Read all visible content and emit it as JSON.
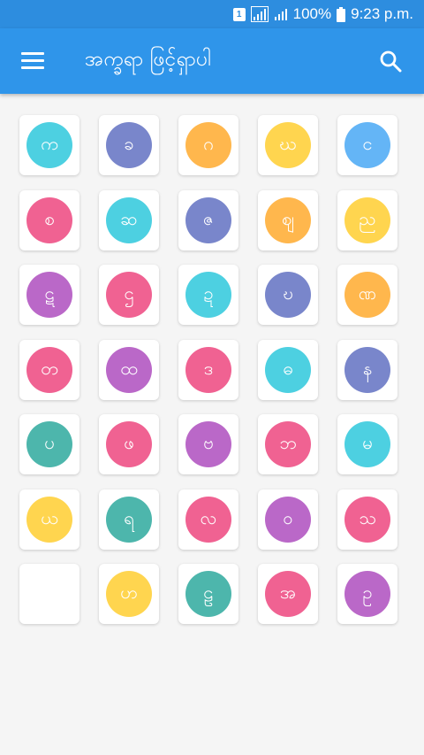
{
  "status_bar": {
    "sim_label": "1",
    "battery_text": "100%",
    "time": "9:23 p.m."
  },
  "app_bar": {
    "title": "အက္ခရာ ဖြင့်ရှာပါ",
    "menu_icon": "hamburger-menu-icon",
    "search_icon": "search-icon"
  },
  "colors": {
    "status_bar": "#2d8ddf",
    "app_bar": "#2f95ea",
    "background": "#f5f5f5"
  },
  "letters": [
    {
      "char": "က",
      "color": "#4dd0e1"
    },
    {
      "char": "ခ",
      "color": "#7986cb"
    },
    {
      "char": "ဂ",
      "color": "#ffb74d"
    },
    {
      "char": "ဃ",
      "color": "#ffd54f"
    },
    {
      "char": "င",
      "color": "#64b5f6"
    },
    {
      "char": "စ",
      "color": "#f06292"
    },
    {
      "char": "ဆ",
      "color": "#4dd0e1"
    },
    {
      "char": "ဇ",
      "color": "#7986cb"
    },
    {
      "char": "ဈ",
      "color": "#ffb74d"
    },
    {
      "char": "ည",
      "color": "#ffd54f"
    },
    {
      "char": "ဋ",
      "color": "#ba68c8"
    },
    {
      "char": "ဌ",
      "color": "#f06292"
    },
    {
      "char": "ဍ",
      "color": "#4dd0e1"
    },
    {
      "char": "ဎ",
      "color": "#7986cb"
    },
    {
      "char": "ဏ",
      "color": "#ffb74d"
    },
    {
      "char": "တ",
      "color": "#f06292"
    },
    {
      "char": "ထ",
      "color": "#ba68c8"
    },
    {
      "char": "ဒ",
      "color": "#f06292"
    },
    {
      "char": "ဓ",
      "color": "#4dd0e1"
    },
    {
      "char": "န",
      "color": "#7986cb"
    },
    {
      "char": "ပ",
      "color": "#4db6ac"
    },
    {
      "char": "ဖ",
      "color": "#f06292"
    },
    {
      "char": "ဗ",
      "color": "#ba68c8"
    },
    {
      "char": "ဘ",
      "color": "#f06292"
    },
    {
      "char": "မ",
      "color": "#4dd0e1"
    },
    {
      "char": "ယ",
      "color": "#ffd54f"
    },
    {
      "char": "ရ",
      "color": "#4db6ac"
    },
    {
      "char": "လ",
      "color": "#f06292"
    },
    {
      "char": "ဝ",
      "color": "#ba68c8"
    },
    {
      "char": "သ",
      "color": "#f06292"
    },
    {
      "char": "",
      "color": ""
    },
    {
      "char": "ဟ",
      "color": "#ffd54f"
    },
    {
      "char": "ဠ",
      "color": "#4db6ac"
    },
    {
      "char": "အ",
      "color": "#f06292"
    },
    {
      "char": "ဥ",
      "color": "#ba68c8"
    }
  ]
}
